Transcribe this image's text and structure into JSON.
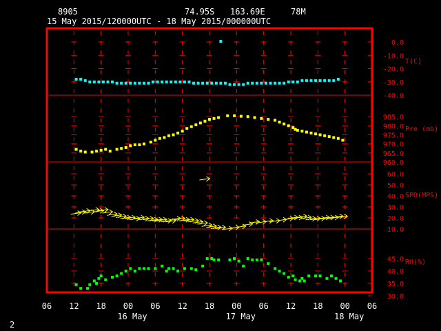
{
  "header": {
    "station_id": "8905",
    "lat": "74.95S",
    "lon": "163.69E",
    "elev": "78M",
    "time_range": "15 May 2015/120000UTC - 18 May 2015/000000UTC"
  },
  "footer_page": "2",
  "chart_data": {
    "type": "scatter",
    "x_unit": "hours since 16 May 00 UTC",
    "x_ticks": [
      {
        "label": "06",
        "hour": -18
      },
      {
        "label": "12",
        "hour": -12
      },
      {
        "label": "18",
        "hour": -6
      },
      {
        "label": "00",
        "hour": 0
      },
      {
        "label": "06",
        "hour": 6
      },
      {
        "label": "12",
        "hour": 12
      },
      {
        "label": "18",
        "hour": 18
      },
      {
        "label": "00",
        "hour": 24
      },
      {
        "label": "06",
        "hour": 30
      },
      {
        "label": "12",
        "hour": 36
      },
      {
        "label": "18",
        "hour": 42
      },
      {
        "label": "00",
        "hour": 48
      },
      {
        "label": "06",
        "hour": 54
      }
    ],
    "date_labels": [
      {
        "label": "16 May",
        "hour": 0
      },
      {
        "label": "17 May",
        "hour": 24
      },
      {
        "label": "18 May",
        "hour": 48
      }
    ],
    "xlim": [
      -18,
      54
    ],
    "colors": {
      "frame": "#ff0000",
      "grid": "#ff0000",
      "text": "#ff0000",
      "temp": "#00ffff",
      "pres": "#ffff00",
      "wind": "#ffff00",
      "rh": "#00ff00"
    },
    "panels": [
      {
        "key": "temp",
        "label": "T(C)",
        "ylim": [
          -40,
          0
        ],
        "ticks": [
          "0.0",
          "-10.0",
          "-20.0",
          "-30.0",
          "-40.0"
        ],
        "tick_values": [
          0,
          -10,
          -20,
          -30,
          -40
        ],
        "points": [
          [
            -11.5,
            -28
          ],
          [
            -10.5,
            -28
          ],
          [
            -9.5,
            -29
          ],
          [
            -8.5,
            -30
          ],
          [
            -7.5,
            -30
          ],
          [
            -6.5,
            -30
          ],
          [
            -5.5,
            -30
          ],
          [
            -4.5,
            -30
          ],
          [
            -3.5,
            -30
          ],
          [
            -2.5,
            -31
          ],
          [
            -1.5,
            -31
          ],
          [
            -0.5,
            -31
          ],
          [
            0.5,
            -31
          ],
          [
            1.5,
            -31
          ],
          [
            2.5,
            -31
          ],
          [
            3.5,
            -31
          ],
          [
            4.5,
            -31
          ],
          [
            5.5,
            -30
          ],
          [
            6.5,
            -30
          ],
          [
            7.5,
            -30
          ],
          [
            8.5,
            -30
          ],
          [
            9.5,
            -30
          ],
          [
            10.5,
            -30
          ],
          [
            11.5,
            -30
          ],
          [
            12.5,
            -30
          ],
          [
            13.5,
            -30
          ],
          [
            14.5,
            -31
          ],
          [
            15.5,
            -31
          ],
          [
            16.5,
            -31
          ],
          [
            17.5,
            -31
          ],
          [
            18.5,
            -31
          ],
          [
            19.5,
            -31
          ],
          [
            20.5,
            -31
          ],
          [
            21.5,
            -31
          ],
          [
            22.5,
            -32
          ],
          [
            23.5,
            -32
          ],
          [
            24.5,
            -32
          ],
          [
            25.5,
            -32
          ],
          [
            26.5,
            -31
          ],
          [
            27.5,
            -31
          ],
          [
            28.5,
            -31
          ],
          [
            29.5,
            -31
          ],
          [
            30.5,
            -31
          ],
          [
            31.5,
            -31
          ],
          [
            32.5,
            -31
          ],
          [
            33.5,
            -31
          ],
          [
            34.5,
            -31
          ],
          [
            35.5,
            -30
          ],
          [
            36.5,
            -30
          ],
          [
            37.5,
            -30
          ],
          [
            38.5,
            -29
          ],
          [
            39.5,
            -29
          ],
          [
            40.5,
            -29
          ],
          [
            41.5,
            -29
          ],
          [
            42.5,
            -29
          ],
          [
            43.5,
            -29
          ],
          [
            44.5,
            -29
          ],
          [
            45.5,
            -29
          ],
          [
            46.5,
            -28
          ],
          [
            20.5,
            0.5
          ]
        ]
      },
      {
        "key": "pres",
        "label": "Pre (mb)",
        "ylim": [
          960,
          990
        ],
        "ticks": [
          "985.0",
          "980.0",
          "975.0",
          "970.0",
          "965.0",
          "960.0"
        ],
        "tick_values": [
          985,
          980,
          975,
          970,
          965,
          960
        ],
        "points": [
          [
            -11.5,
            967
          ],
          [
            -10.5,
            966
          ],
          [
            -9.5,
            965.5
          ],
          [
            -8,
            965.5
          ],
          [
            -7,
            966
          ],
          [
            -6,
            966.5
          ],
          [
            -5,
            967
          ],
          [
            -4,
            966
          ],
          [
            -2.5,
            967
          ],
          [
            -1.5,
            967.5
          ],
          [
            -0.5,
            968
          ],
          [
            0.5,
            969
          ],
          [
            1.5,
            969.5
          ],
          [
            2.5,
            969.5
          ],
          [
            3.5,
            970
          ],
          [
            5,
            971
          ],
          [
            6,
            972
          ],
          [
            7,
            973
          ],
          [
            8,
            973.5
          ],
          [
            9,
            974.5
          ],
          [
            10,
            975
          ],
          [
            11,
            976
          ],
          [
            12,
            977
          ],
          [
            13,
            978.5
          ],
          [
            14,
            979.5
          ],
          [
            15,
            980.5
          ],
          [
            16,
            981.5
          ],
          [
            17,
            982.5
          ],
          [
            18,
            983.5
          ],
          [
            19,
            984
          ],
          [
            20,
            984.5
          ],
          [
            22,
            985.5
          ],
          [
            23.5,
            985.5
          ],
          [
            25,
            985.2
          ],
          [
            26.5,
            985
          ],
          [
            28,
            984.5
          ],
          [
            29.5,
            984
          ],
          [
            31,
            983.5
          ],
          [
            32.5,
            983
          ],
          [
            33.5,
            982
          ],
          [
            34.5,
            981
          ],
          [
            35.5,
            980
          ],
          [
            36.5,
            979
          ],
          [
            37,
            978
          ],
          [
            37.5,
            977.5
          ],
          [
            38.5,
            977
          ],
          [
            39.5,
            976.5
          ],
          [
            40.5,
            976
          ],
          [
            41.5,
            975.5
          ],
          [
            42.5,
            975
          ],
          [
            43.5,
            974.5
          ],
          [
            44.5,
            974
          ],
          [
            45.5,
            973.5
          ],
          [
            46.5,
            973
          ],
          [
            47.5,
            972
          ]
        ]
      },
      {
        "key": "wind",
        "label": "SPD(MPS)",
        "ylim": [
          10,
          60
        ],
        "ticks": [
          "60.0",
          "50.0",
          "40.0",
          "30.0",
          "20.0",
          "10.0"
        ],
        "tick_values": [
          60,
          50,
          40,
          30,
          20,
          10
        ],
        "points": [
          [
            -11.5,
            24
          ],
          [
            -10.5,
            25
          ],
          [
            -9.5,
            26
          ],
          [
            -8.5,
            25
          ],
          [
            -7.5,
            27
          ],
          [
            -6.5,
            26
          ],
          [
            -5.5,
            27
          ],
          [
            -4.5,
            25
          ],
          [
            -3.5,
            23
          ],
          [
            -2.5,
            22
          ],
          [
            -1.5,
            21
          ],
          [
            -0.5,
            20
          ],
          [
            0.5,
            20
          ],
          [
            1.5,
            19
          ],
          [
            2.5,
            20
          ],
          [
            3.5,
            19
          ],
          [
            4.5,
            19
          ],
          [
            5.5,
            18
          ],
          [
            6.5,
            18
          ],
          [
            7.5,
            18
          ],
          [
            8.5,
            17
          ],
          [
            9.5,
            17
          ],
          [
            10.5,
            19
          ],
          [
            11.5,
            19
          ],
          [
            12.5,
            18
          ],
          [
            13.5,
            18
          ],
          [
            14.5,
            17
          ],
          [
            15.5,
            16
          ],
          [
            16.5,
            15
          ],
          [
            17.5,
            13
          ],
          [
            18.5,
            12
          ],
          [
            19.5,
            11
          ],
          [
            20.5,
            11
          ],
          [
            22,
            10
          ],
          [
            23.5,
            11
          ],
          [
            25,
            12
          ],
          [
            26.5,
            14
          ],
          [
            28,
            16
          ],
          [
            29.5,
            16
          ],
          [
            31,
            17
          ],
          [
            32.5,
            17
          ],
          [
            34,
            18
          ],
          [
            35.5,
            19
          ],
          [
            36.5,
            20
          ],
          [
            37.5,
            20
          ],
          [
            38.5,
            21
          ],
          [
            39.5,
            20
          ],
          [
            40.5,
            19
          ],
          [
            41.5,
            19
          ],
          [
            42.5,
            19
          ],
          [
            43.5,
            20
          ],
          [
            44.5,
            20
          ],
          [
            45.5,
            20
          ],
          [
            46.5,
            21
          ],
          [
            47.5,
            21
          ],
          [
            17,
            55
          ]
        ]
      },
      {
        "key": "rh",
        "label": "RH(%)",
        "ylim": [
          30,
          50
        ],
        "ticks": [
          "45.0",
          "40.0",
          "35.0",
          "30.0"
        ],
        "tick_values": [
          45,
          40,
          35,
          30
        ],
        "points": [
          [
            -11.5,
            34.5
          ],
          [
            -10.5,
            33
          ],
          [
            -9,
            33
          ],
          [
            -8.5,
            34.5
          ],
          [
            -7.5,
            36
          ],
          [
            -7,
            35
          ],
          [
            -6.5,
            37
          ],
          [
            -6,
            38
          ],
          [
            -5,
            36.5
          ],
          [
            -3.5,
            37.5
          ],
          [
            -2.5,
            38
          ],
          [
            -1.5,
            39
          ],
          [
            -0.5,
            40
          ],
          [
            0.5,
            41
          ],
          [
            1.5,
            40
          ],
          [
            2.5,
            41
          ],
          [
            3.5,
            41
          ],
          [
            4.5,
            41
          ],
          [
            6,
            41
          ],
          [
            7.5,
            42
          ],
          [
            8.5,
            40
          ],
          [
            9,
            41
          ],
          [
            10,
            41
          ],
          [
            11,
            40
          ],
          [
            12.5,
            41
          ],
          [
            14,
            41
          ],
          [
            15,
            40.5
          ],
          [
            16.5,
            42
          ],
          [
            17.5,
            45
          ],
          [
            18.5,
            45
          ],
          [
            19,
            44.5
          ],
          [
            20,
            44.5
          ],
          [
            22.5,
            44.5
          ],
          [
            23.5,
            45
          ],
          [
            24.5,
            44
          ],
          [
            25.5,
            42
          ],
          [
            26.5,
            45
          ],
          [
            27.5,
            44.5
          ],
          [
            28.5,
            44.5
          ],
          [
            29.5,
            44.5
          ],
          [
            31,
            43
          ],
          [
            32.5,
            41
          ],
          [
            33.5,
            40
          ],
          [
            34.5,
            39
          ],
          [
            35.5,
            37.5
          ],
          [
            36.5,
            38
          ],
          [
            37,
            36.5
          ],
          [
            38,
            36
          ],
          [
            38.5,
            37
          ],
          [
            39,
            36
          ],
          [
            40,
            38
          ],
          [
            41.5,
            38
          ],
          [
            42.5,
            38
          ],
          [
            44,
            37
          ],
          [
            45,
            38
          ],
          [
            46,
            37
          ],
          [
            47,
            36
          ]
        ]
      }
    ]
  }
}
